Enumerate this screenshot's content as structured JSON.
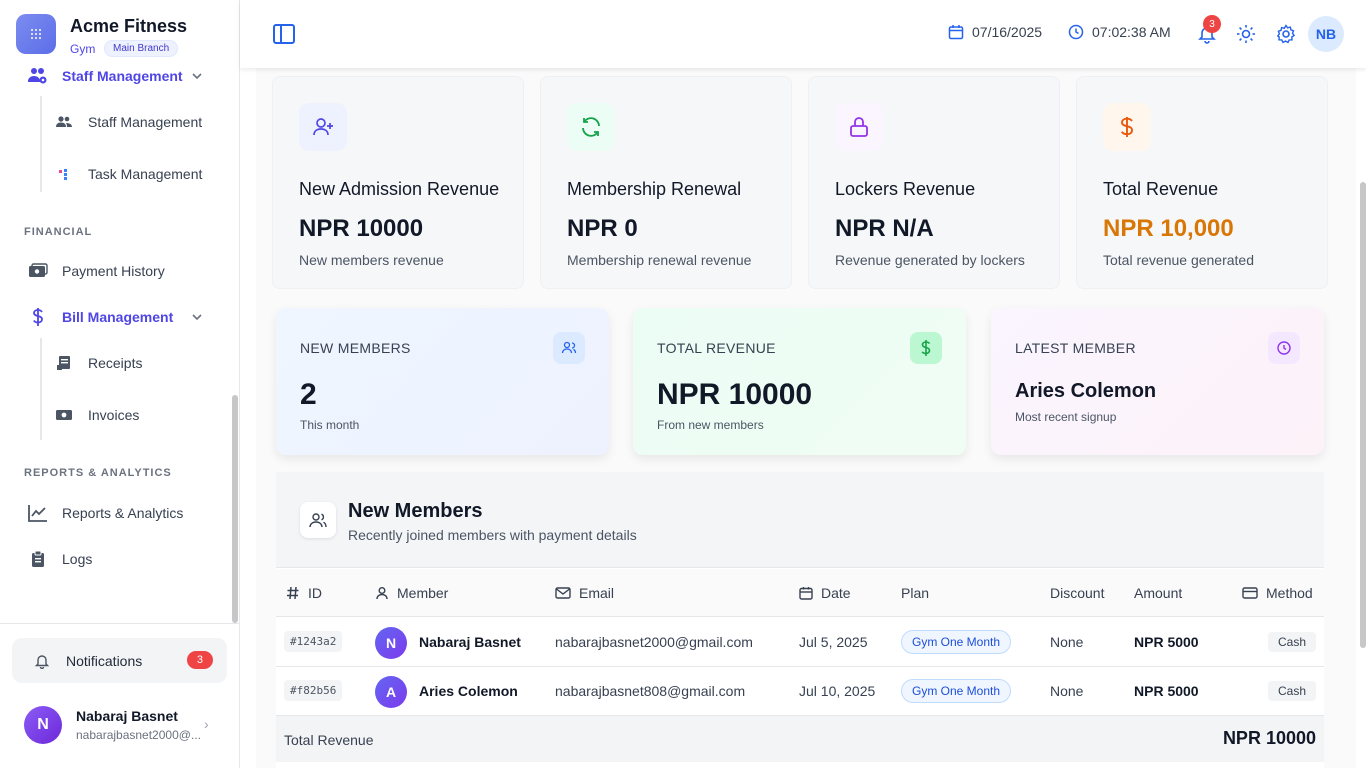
{
  "brand": {
    "name": "Acme Fitness",
    "type": "Gym",
    "branch": "Main Branch"
  },
  "sidebar": {
    "staff_management": "Staff Management",
    "staff_sub": [
      "Staff Management",
      "Task Management"
    ],
    "financial_title": "FINANCIAL",
    "payment_history": "Payment History",
    "bill_management": "Bill Management",
    "bill_sub": [
      "Receipts",
      "Invoices"
    ],
    "reports_title": "REPORTS & ANALYTICS",
    "reports": "Reports & Analytics",
    "logs": "Logs",
    "notifications_label": "Notifications",
    "notifications_count": "3",
    "user": {
      "initial": "N",
      "name": "Nabaraj Basnet",
      "email": "nabarajbasnet2000@..."
    }
  },
  "header": {
    "date": "07/16/2025",
    "time": "07:02:38 AM",
    "bell_count": "3",
    "avatar": "NB"
  },
  "revenue_cards": [
    {
      "title": "New Admission Revenue",
      "value": "NPR 10000",
      "sub": "New members revenue"
    },
    {
      "title": "Membership Renewal",
      "value": "NPR 0",
      "sub": "Membership renewal revenue"
    },
    {
      "title": "Lockers Revenue",
      "value": "NPR N/A",
      "sub": "Revenue generated by lockers"
    },
    {
      "title": "Total Revenue",
      "value": "NPR 10,000",
      "sub": "Total revenue generated"
    }
  ],
  "stat_cards": [
    {
      "label": "NEW MEMBERS",
      "value": "2",
      "sub": "This month"
    },
    {
      "label": "TOTAL REVENUE",
      "value": "NPR 10000",
      "sub": "From new members"
    },
    {
      "label": "LATEST MEMBER",
      "value": "Aries Colemon",
      "sub": "Most recent signup"
    }
  ],
  "table": {
    "title": "New Members",
    "subtitle": "Recently joined members with payment details",
    "columns": [
      "ID",
      "Member",
      "Email",
      "Date",
      "Plan",
      "Discount",
      "Amount",
      "Method"
    ],
    "rows": [
      {
        "id": "#1243a2",
        "initial": "N",
        "member": "Nabaraj Basnet",
        "email": "nabarajbasnet2000@gmail.com",
        "date": "Jul 5, 2025",
        "plan": "Gym One Month",
        "discount": "None",
        "amount": "NPR 5000",
        "method": "Cash"
      },
      {
        "id": "#f82b56",
        "initial": "A",
        "member": "Aries Colemon",
        "email": "nabarajbasnet808@gmail.com",
        "date": "Jul 10, 2025",
        "plan": "Gym One Month",
        "discount": "None",
        "amount": "NPR 5000",
        "method": "Cash"
      }
    ],
    "total_label": "Total Revenue",
    "total_value": "NPR 10000"
  },
  "colors": {
    "accent": "#4f46e5",
    "total_revenue": "#d97706",
    "badge_red": "#ef4444"
  }
}
